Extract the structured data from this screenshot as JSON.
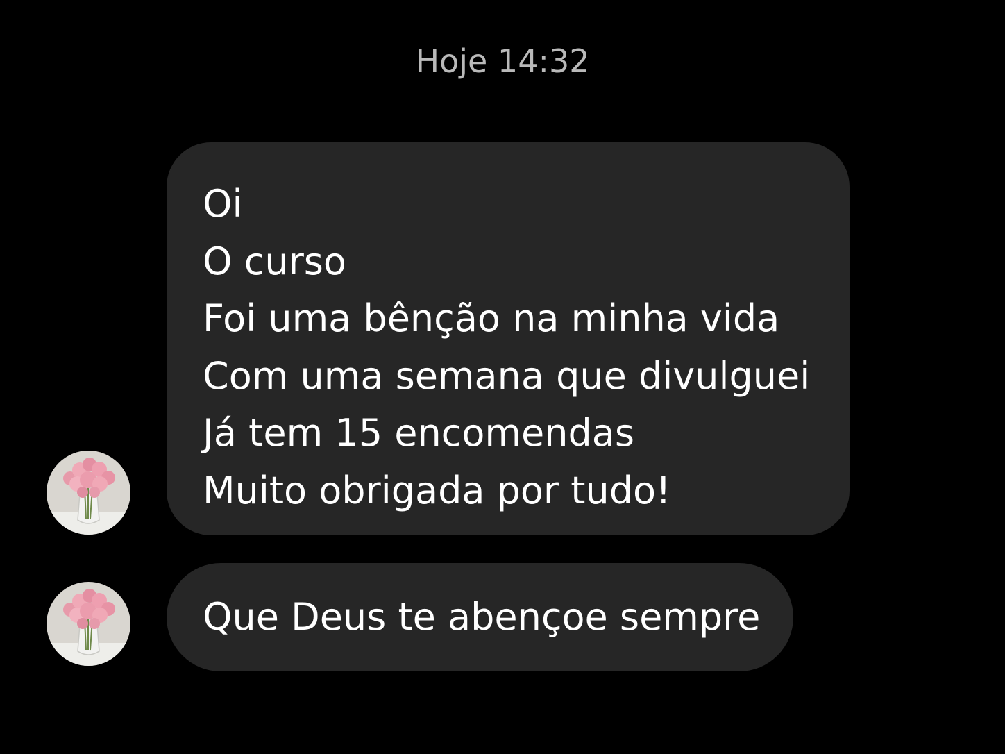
{
  "conversation": {
    "timestamp": "Hoje 14:32",
    "messages": [
      {
        "lines": [
          "Oi",
          "O curso",
          "Foi uma bênção na minha vida",
          "Com uma semana que divulguei",
          "Já tem 15 encomendas",
          "Muito obrigada por tudo!"
        ],
        "avatar_icon": "pink-roses-vase"
      },
      {
        "lines": [
          "Que Deus te abençoe sempre"
        ],
        "avatar_icon": "pink-roses-vase"
      }
    ]
  },
  "colors": {
    "background": "#000000",
    "bubble": "#262626",
    "message_text": "#ffffff",
    "timestamp_text": "#b9b9b9"
  }
}
